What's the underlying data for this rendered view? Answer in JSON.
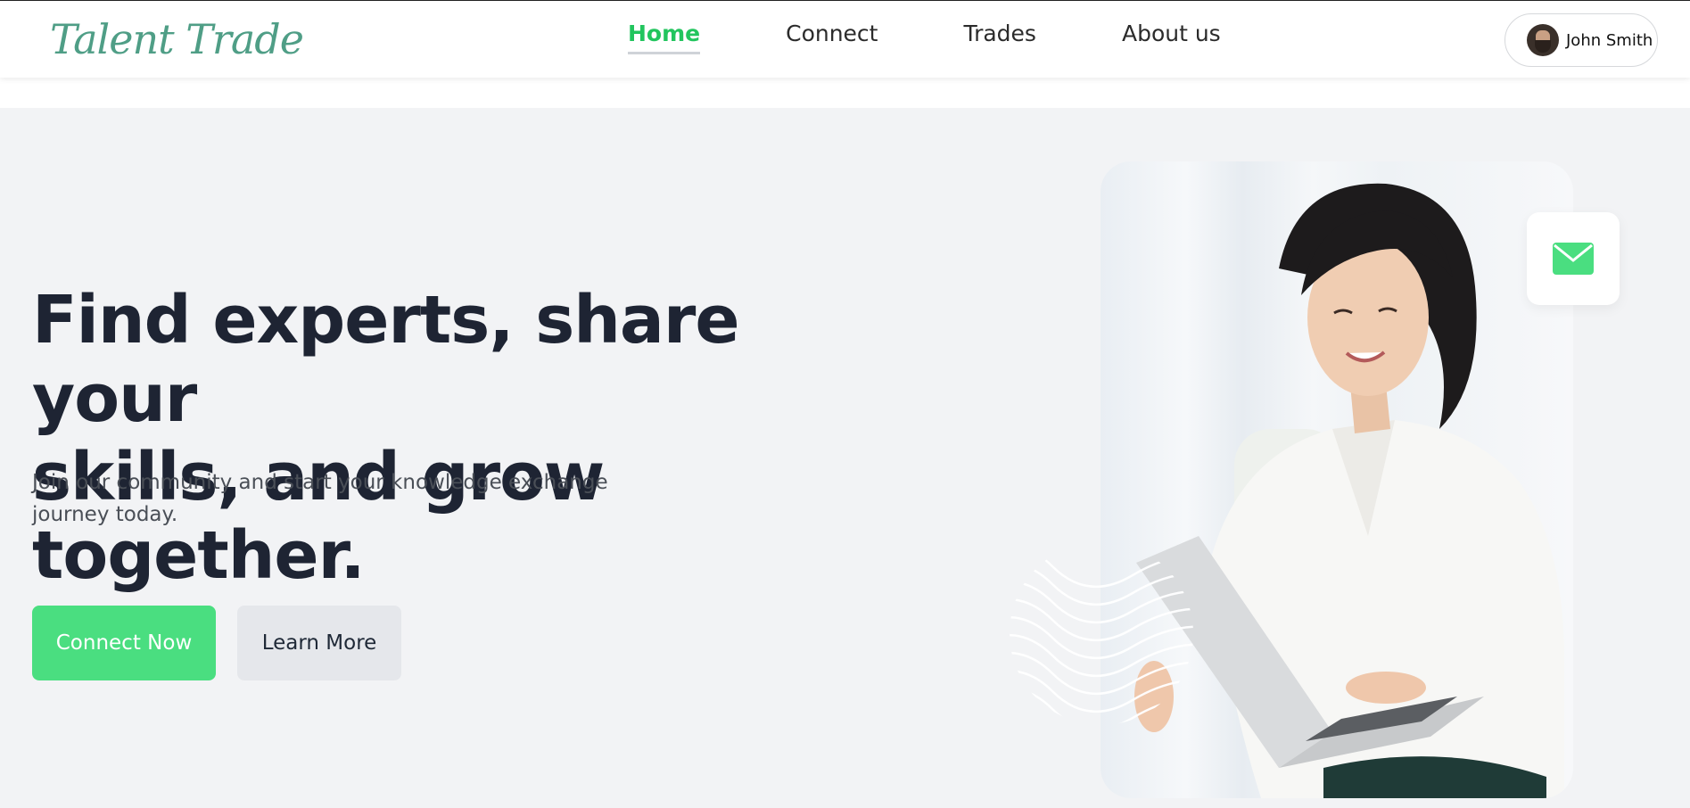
{
  "brand": {
    "name": "Talent Trade",
    "accent_color": "#4ade80",
    "logo_text_color": "#4f9e86"
  },
  "nav": {
    "items": [
      {
        "label": "Home",
        "active": true
      },
      {
        "label": "Connect",
        "active": false
      },
      {
        "label": "Trades",
        "active": false
      },
      {
        "label": "About us",
        "active": false
      }
    ],
    "active_color": "#22c55e"
  },
  "user": {
    "name": "John Smith",
    "avatar_icon": "user-avatar"
  },
  "hero": {
    "title_line1": "Find experts, share your",
    "title_line2": "skills, and grow together.",
    "subtitle": "Join our community and start your knowledge exchange journey today.",
    "primary_button": "Connect Now",
    "secondary_button": "Learn More"
  },
  "media": {
    "photo_alt": "Woman smiling while using a laptop",
    "mail_icon": "envelope-icon",
    "decoration_icon": "wave-lines-icon"
  }
}
